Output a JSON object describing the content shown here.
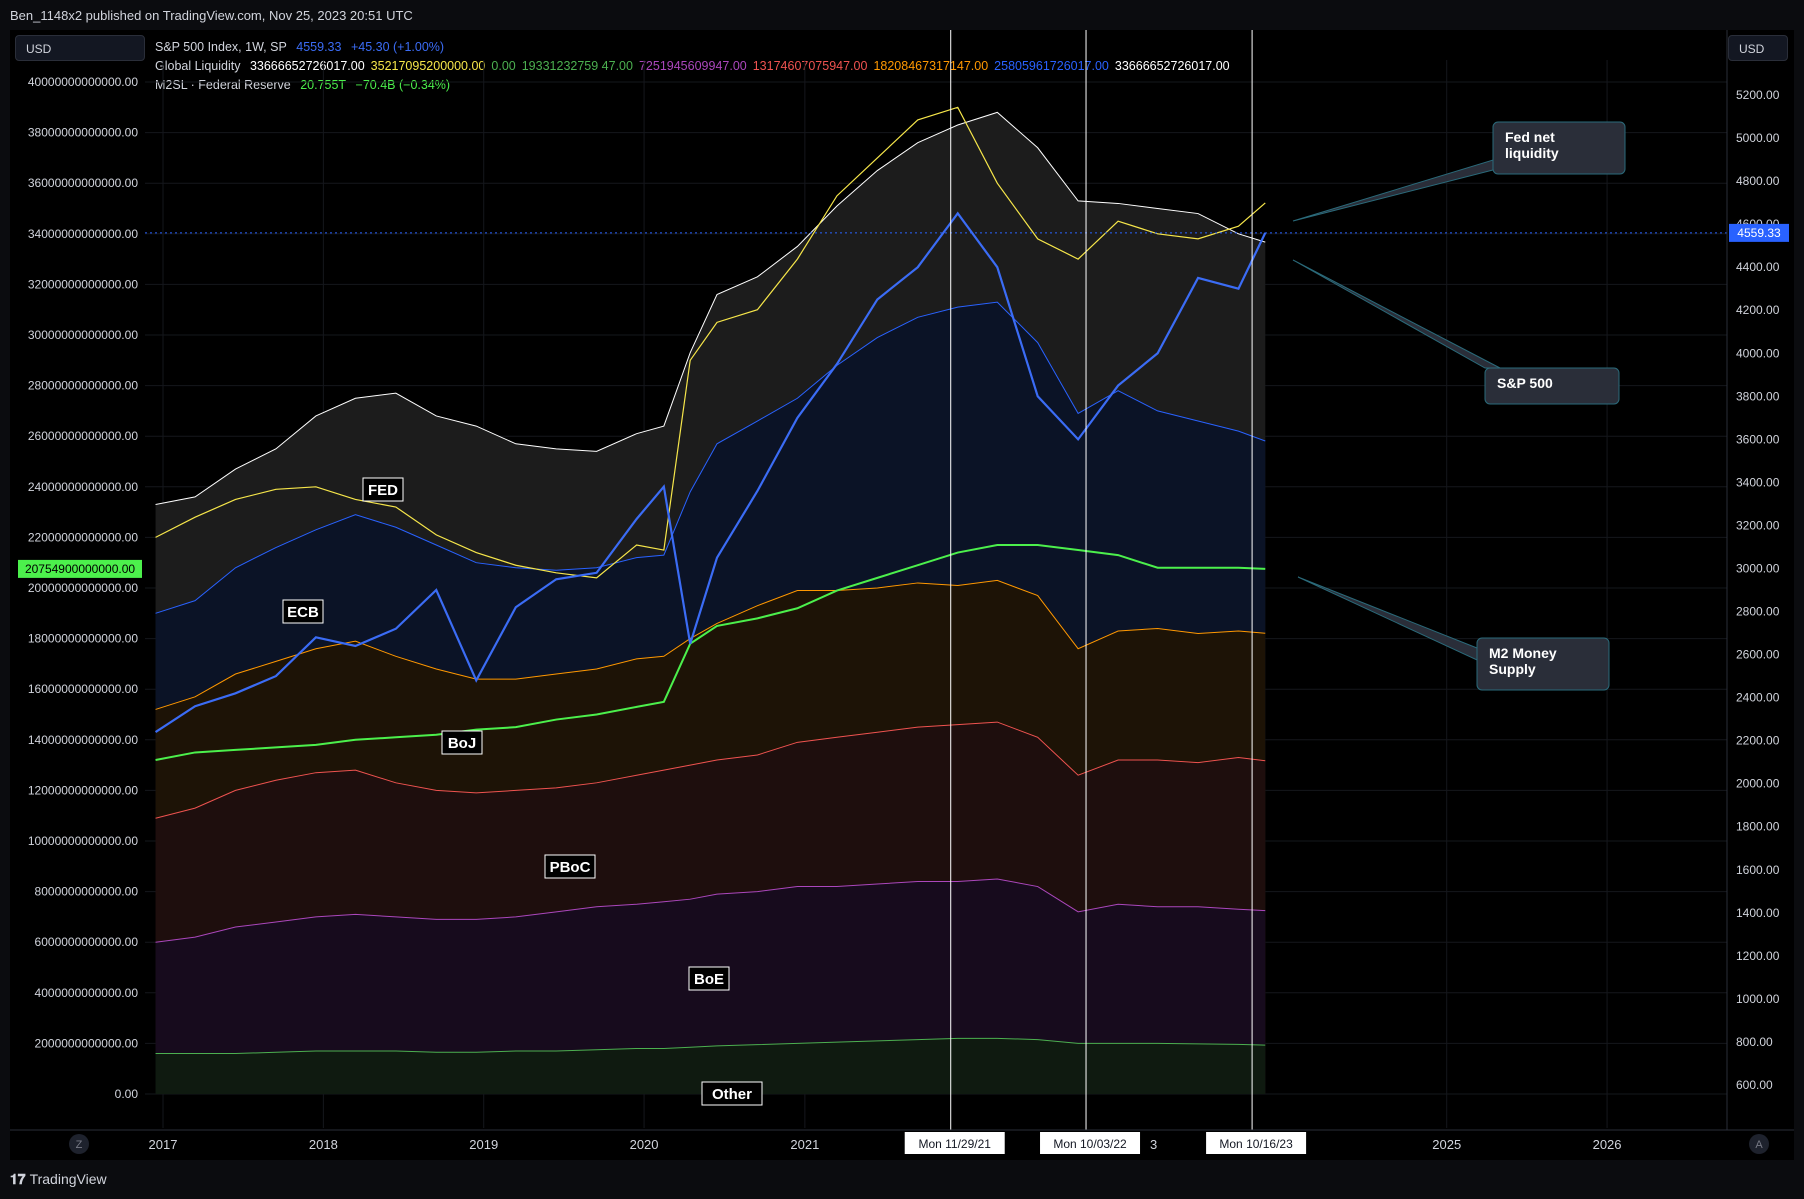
{
  "header": {
    "published": "Ben_1148x2 published on TradingView.com, Nov 25, 2023 20:51 UTC"
  },
  "scales": {
    "left_currency": "USD",
    "right_currency": "USD",
    "left_ticks": [
      "40000000000000.00",
      "38000000000000.00",
      "36000000000000.00",
      "34000000000000.00",
      "32000000000000.00",
      "30000000000000.00",
      "28000000000000.00",
      "26000000000000.00",
      "24000000000000.00",
      "22000000000000.00",
      "20000000000000.00",
      "18000000000000.00",
      "16000000000000.00",
      "14000000000000.00",
      "12000000000000.00",
      "10000000000000.00",
      "8000000000000.00",
      "6000000000000.00",
      "4000000000000.00",
      "2000000000000.00",
      "0.00"
    ],
    "right_ticks": [
      "5200.00",
      "5000.00",
      "4800.00",
      "4600.00",
      "4400.00",
      "4200.00",
      "4000.00",
      "3800.00",
      "3600.00",
      "3400.00",
      "3200.00",
      "3000.00",
      "2800.00",
      "2600.00",
      "2400.00",
      "2200.00",
      "2000.00",
      "1800.00",
      "1600.00",
      "1400.00",
      "1200.00",
      "1000.00",
      "800.00",
      "600.00"
    ],
    "left_badge": "20754900000000.00",
    "right_badge": "4559.33",
    "bottom_left_btn": "Z",
    "bottom_right_btn": "A"
  },
  "legend": {
    "sp500": {
      "name": "S&P 500 Index, 1W, SP",
      "value": "4559.33",
      "change": "+45.30 (+1.00%)"
    },
    "global_liquidity": {
      "name": "Global Liquidity",
      "values": [
        {
          "text": "33666652726017.00",
          "color": "#ffffff"
        },
        {
          "text": "35217095200000.00",
          "color": "#f6e64a"
        },
        {
          "text": "0.00",
          "color": "#4caf50"
        },
        {
          "text": "19331232759 47.00",
          "color": "#4caf50"
        },
        {
          "text": "7251945609947.00",
          "color": "#ab47bc"
        },
        {
          "text": "13174607075947.00",
          "color": "#ef5350"
        },
        {
          "text": "18208467317147.00",
          "color": "#ff9800"
        },
        {
          "text": "25805961726017.00",
          "color": "#2962ff"
        },
        {
          "text": "33666652726017.00",
          "color": "#ffffff"
        }
      ]
    },
    "m2": {
      "name": "M2SL · Federal Reserve",
      "value": "20.755T",
      "change": "−70.4B (−0.34%)"
    }
  },
  "x_axis": {
    "labels": [
      "2017",
      "2018",
      "2019",
      "2020",
      "2021",
      "2025",
      "2026"
    ],
    "markers": [
      "Mon 11/29/21",
      "Mon 10/03/22",
      "Mon 10/16/23"
    ],
    "hidden_fragment": "3"
  },
  "annotations": {
    "callouts": [
      {
        "text": [
          "Fed net",
          "liquidity"
        ]
      },
      {
        "text": [
          "S&P 500"
        ]
      },
      {
        "text": [
          "M2 Money",
          "Supply"
        ]
      }
    ],
    "layer_labels": [
      "FED",
      "ECB",
      "BoJ",
      "PBoC",
      "BoE",
      "Other"
    ]
  },
  "footer": {
    "brand": "TradingView",
    "brand_icon": "tradingview-logo-icon"
  },
  "colors": {
    "background": "#000000",
    "fed": "#ffffff",
    "ecb": "#2962ff",
    "boj": "#ff9800",
    "pboc": "#ef5350",
    "boe": "#ab47bc",
    "other": "#4caf50",
    "sp500": "#3b6cf5",
    "m2": "#4cf04c",
    "fed_net_liquidity": "#f6e64a",
    "price_line": "#2962ff",
    "marker": "#ffffff"
  },
  "chart_data": {
    "type": "area",
    "x_range": [
      "2016-11-21",
      "2026-10-01"
    ],
    "left_axis": {
      "ylim": [
        0,
        40000000000000
      ],
      "unit": "USD"
    },
    "right_axis": {
      "ylim": [
        600,
        5200
      ],
      "unit": "USD"
    },
    "x": [
      "2016-12",
      "2017-03",
      "2017-06",
      "2017-09",
      "2017-12",
      "2018-03",
      "2018-06",
      "2018-09",
      "2018-12",
      "2019-03",
      "2019-06",
      "2019-09",
      "2019-12",
      "2020-02",
      "2020-04",
      "2020-06",
      "2020-09",
      "2020-12",
      "2021-03",
      "2021-06",
      "2021-09",
      "2021-12",
      "2022-03",
      "2022-06",
      "2022-09",
      "2022-12",
      "2023-03",
      "2023-06",
      "2023-09",
      "2023-11"
    ],
    "series": [
      {
        "name": "FED",
        "axis": "left",
        "values": [
          23300000000000,
          23600000000000,
          24700000000000,
          25500000000000,
          26800000000000,
          27500000000000,
          27700000000000,
          26800000000000,
          26400000000000,
          25700000000000,
          25500000000000,
          25400000000000,
          26100000000000,
          26400000000000,
          29300000000000,
          31600000000000,
          32300000000000,
          33500000000000,
          35100000000000,
          36500000000000,
          37600000000000,
          38300000000000,
          38800000000000,
          37400000000000,
          35300000000000,
          35200000000000,
          35000000000000,
          34800000000000,
          34000000000000,
          33670000000000
        ]
      },
      {
        "name": "ECB",
        "axis": "left",
        "values": [
          19000000000000,
          19500000000000,
          20800000000000,
          21600000000000,
          22300000000000,
          22900000000000,
          22400000000000,
          21700000000000,
          21000000000000,
          20800000000000,
          20700000000000,
          20800000000000,
          21200000000000,
          21300000000000,
          23800000000000,
          25700000000000,
          26600000000000,
          27500000000000,
          28800000000000,
          29900000000000,
          30700000000000,
          31100000000000,
          31300000000000,
          29700000000000,
          26900000000000,
          27800000000000,
          27000000000000,
          26600000000000,
          26200000000000,
          25810000000000
        ]
      },
      {
        "name": "BoJ",
        "axis": "left",
        "values": [
          15200000000000,
          15700000000000,
          16600000000000,
          17100000000000,
          17600000000000,
          17900000000000,
          17300000000000,
          16800000000000,
          16400000000000,
          16400000000000,
          16600000000000,
          16800000000000,
          17200000000000,
          17300000000000,
          18000000000000,
          18600000000000,
          19300000000000,
          19900000000000,
          19900000000000,
          20000000000000,
          20200000000000,
          20100000000000,
          20300000000000,
          19700000000000,
          17600000000000,
          18300000000000,
          18400000000000,
          18200000000000,
          18300000000000,
          18210000000000
        ]
      },
      {
        "name": "PBoC",
        "axis": "left",
        "values": [
          10900000000000,
          11300000000000,
          12000000000000,
          12400000000000,
          12700000000000,
          12800000000000,
          12300000000000,
          12000000000000,
          11900000000000,
          12000000000000,
          12100000000000,
          12300000000000,
          12600000000000,
          12800000000000,
          13000000000000,
          13200000000000,
          13400000000000,
          13900000000000,
          14100000000000,
          14300000000000,
          14500000000000,
          14600000000000,
          14700000000000,
          14100000000000,
          12600000000000,
          13200000000000,
          13200000000000,
          13100000000000,
          13300000000000,
          13170000000000
        ]
      },
      {
        "name": "BoE",
        "axis": "left",
        "values": [
          6000000000000,
          6200000000000,
          6600000000000,
          6800000000000,
          7000000000000,
          7100000000000,
          7000000000000,
          6900000000000,
          6900000000000,
          7000000000000,
          7200000000000,
          7400000000000,
          7500000000000,
          7600000000000,
          7700000000000,
          7900000000000,
          8000000000000,
          8200000000000,
          8200000000000,
          8300000000000,
          8400000000000,
          8400000000000,
          8500000000000,
          8200000000000,
          7200000000000,
          7500000000000,
          7400000000000,
          7400000000000,
          7300000000000,
          7250000000000
        ]
      },
      {
        "name": "Other",
        "axis": "left",
        "values": [
          1600000000000,
          1600000000000,
          1600000000000,
          1650000000000,
          1700000000000,
          1700000000000,
          1700000000000,
          1650000000000,
          1650000000000,
          1700000000000,
          1700000000000,
          1750000000000,
          1800000000000,
          1800000000000,
          1850000000000,
          1900000000000,
          1950000000000,
          2000000000000,
          2050000000000,
          2100000000000,
          2150000000000,
          2200000000000,
          2200000000000,
          2150000000000,
          2000000000000,
          2000000000000,
          2000000000000,
          1980000000000,
          1960000000000,
          1930000000000
        ]
      },
      {
        "name": "Fed net liquidity",
        "axis": "left",
        "values": [
          22000000000000,
          22800000000000,
          23500000000000,
          23900000000000,
          24000000000000,
          23500000000000,
          23200000000000,
          22100000000000,
          21400000000000,
          20900000000000,
          20600000000000,
          20400000000000,
          21700000000000,
          21500000000000,
          29000000000000,
          30500000000000,
          31000000000000,
          33000000000000,
          35500000000000,
          37000000000000,
          38500000000000,
          39000000000000,
          36000000000000,
          33800000000000,
          33000000000000,
          34500000000000,
          34000000000000,
          33800000000000,
          34300000000000,
          35220000000000
        ]
      },
      {
        "name": "S&P 500",
        "axis": "right",
        "values": [
          2240,
          2360,
          2420,
          2500,
          2680,
          2640,
          2720,
          2900,
          2480,
          2820,
          2950,
          2980,
          3230,
          3380,
          2650,
          3050,
          3360,
          3700,
          3950,
          4250,
          4400,
          4650,
          4400,
          3800,
          3600,
          3850,
          4000,
          4350,
          4300,
          4559.33
        ]
      },
      {
        "name": "M2 Money Supply",
        "axis": "left",
        "values": [
          13200000000000,
          13500000000000,
          13600000000000,
          13700000000000,
          13800000000000,
          14000000000000,
          14100000000000,
          14200000000000,
          14400000000000,
          14500000000000,
          14800000000000,
          15000000000000,
          15300000000000,
          15500000000000,
          17800000000000,
          18500000000000,
          18800000000000,
          19200000000000,
          19900000000000,
          20400000000000,
          20900000000000,
          21400000000000,
          21700000000000,
          21700000000000,
          21500000000000,
          21300000000000,
          20800000000000,
          20800000000000,
          20800000000000,
          20755000000000
        ]
      }
    ]
  }
}
